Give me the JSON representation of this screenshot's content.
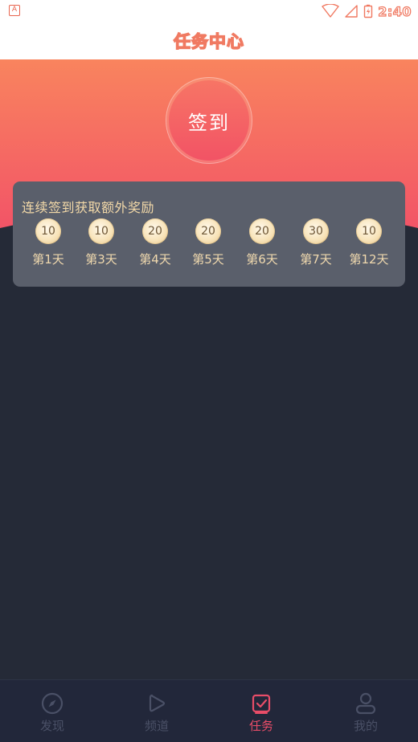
{
  "status_bar": {
    "app_icon_letter": "A",
    "time": "2:40"
  },
  "header": {
    "title": "任务中心"
  },
  "checkin": {
    "button_label": "签到"
  },
  "reward_card": {
    "title": "连续签到获取额外奖励",
    "days": [
      {
        "points": "10",
        "label": "第1天"
      },
      {
        "points": "10",
        "label": "第3天"
      },
      {
        "points": "20",
        "label": "第4天"
      },
      {
        "points": "20",
        "label": "第5天"
      },
      {
        "points": "20",
        "label": "第6天"
      },
      {
        "points": "30",
        "label": "第7天"
      },
      {
        "points": "10",
        "label": "第12天"
      }
    ]
  },
  "bottom_nav": {
    "items": [
      {
        "label": "发现",
        "icon": "compass-icon",
        "active": false
      },
      {
        "label": "频道",
        "icon": "play-icon",
        "active": false
      },
      {
        "label": "任务",
        "icon": "task-check-icon",
        "active": true
      },
      {
        "label": "我的",
        "icon": "user-icon",
        "active": false
      }
    ]
  },
  "colors": {
    "background": "#252a37",
    "gradient_top": "#f9845e",
    "gradient_bottom": "#f25467",
    "accent": "#e84d68",
    "reward_text": "#f3d9a8",
    "nav_inactive": "#4a5066"
  }
}
